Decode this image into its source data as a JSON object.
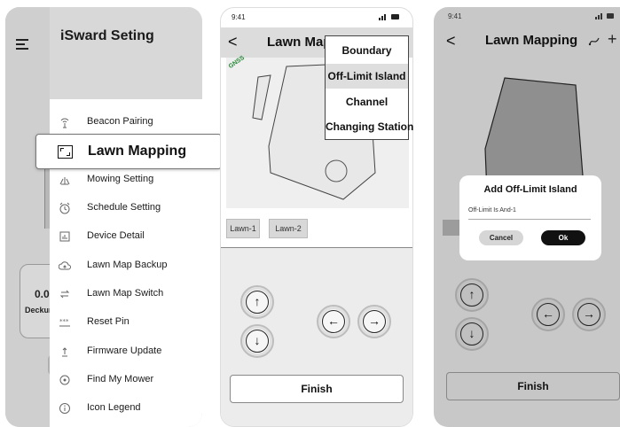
{
  "drawer": {
    "title": "iSward Seting",
    "items": [
      {
        "label": "Beacon Pairing",
        "icon": "antenna-icon"
      },
      {
        "label": "Lawn Mapping",
        "icon": "map-frame-icon"
      },
      {
        "label": "Mowing Setting",
        "icon": "grass-icon"
      },
      {
        "label": "Schedule Setting",
        "icon": "alarm-clock-icon"
      },
      {
        "label": "Device Detail",
        "icon": "chart-icon"
      },
      {
        "label": "Lawn Map Backup",
        "icon": "cloud-icon"
      },
      {
        "label": "Lawn Map Switch",
        "icon": "swap-icon"
      },
      {
        "label": "Reset Pin",
        "icon": "password-icon"
      },
      {
        "label": "Firmware Update",
        "icon": "upload-icon"
      },
      {
        "label": "Find My Mower",
        "icon": "location-icon"
      },
      {
        "label": "Icon Legend",
        "icon": "info-icon"
      }
    ],
    "background_stat": {
      "value": "0.0",
      "label": "Deckun"
    }
  },
  "mapping": {
    "status_time": "9:41",
    "title": "Lawn Mapping",
    "back": "<",
    "menu": [
      "Boundary",
      "Off-Limit Island",
      "Channel",
      "Changing Station"
    ],
    "selected_menu": "Off-Limit Island",
    "lawns": [
      "Lawn-1",
      "Lawn-2"
    ],
    "arrows": {
      "up": "↑",
      "down": "↓",
      "left": "←",
      "right": "→"
    },
    "finish": "Finish"
  },
  "dialog_screen": {
    "status_time": "9:41",
    "title": "Lawn Mapping",
    "back": "<",
    "header_icons": [
      "route-icon",
      "plus-icon"
    ],
    "dialog": {
      "title": "Add Off-Limit Island",
      "value": "Off-Limit Is And-1",
      "cancel": "Cancel",
      "ok": "Ok"
    },
    "finish": "Finish"
  }
}
